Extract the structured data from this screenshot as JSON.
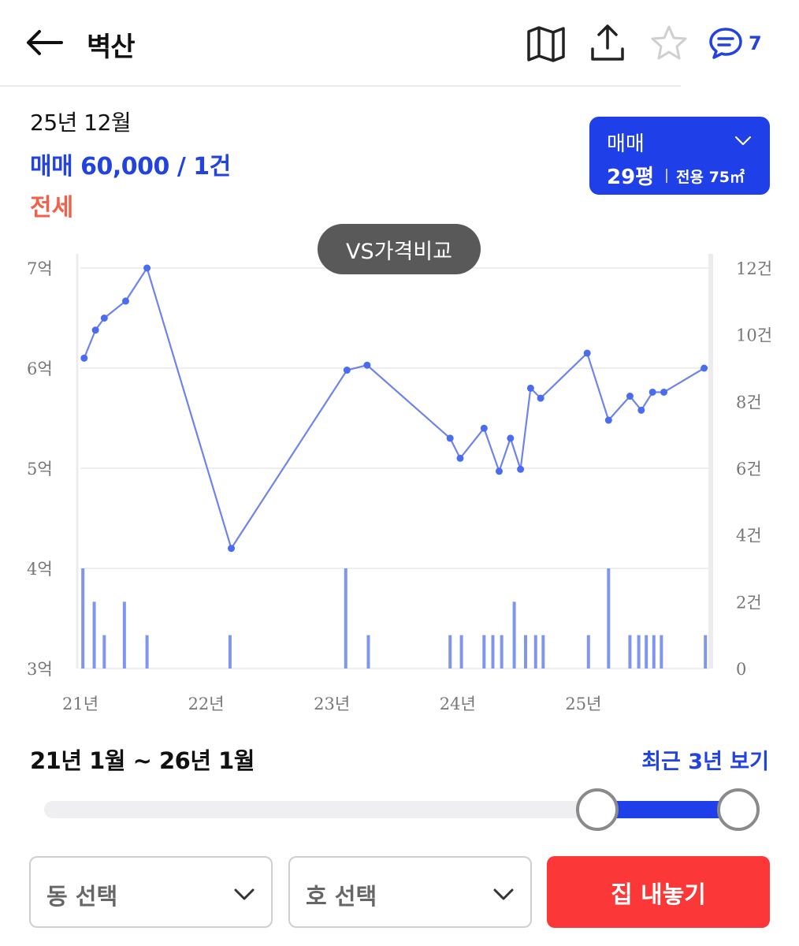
{
  "header": {
    "title": "벽산",
    "comment_count": "7",
    "icons": [
      "back-arrow-icon",
      "map-icon",
      "share-icon",
      "star-icon",
      "comment-icon"
    ]
  },
  "summary": {
    "period": "25년 12월",
    "sale_line": "매매 60,000 / 1건",
    "jeonse_line": "전세"
  },
  "type_select": {
    "trade_type": "매매",
    "size": "29평",
    "area": "전용 75㎡"
  },
  "vs_button": "VS가격비교",
  "colors": {
    "accent": "#1f3fe8",
    "line": "#6f84ea",
    "bar": "#8095f0",
    "dot": "#4a6cf0",
    "jeonse": "#f0604a",
    "sell": "#fb3737"
  },
  "chart_data": {
    "type": "line",
    "x_tick_labels": [
      "21년",
      "22년",
      "23년",
      "24년",
      "25년"
    ],
    "x_tick_positions": [
      2021,
      2022,
      2023,
      2024,
      2025
    ],
    "xlim": [
      2021,
      2026
    ],
    "y_left_ticks": [
      "3억",
      "4억",
      "5억",
      "6억",
      "7억"
    ],
    "y_left_values": [
      3,
      4,
      5,
      6,
      7
    ],
    "ylim_left": [
      3,
      7
    ],
    "y_right_ticks": [
      "0",
      "2건",
      "4건",
      "6건",
      "8건",
      "10건",
      "12건"
    ],
    "y_right_values": [
      0,
      2,
      4,
      6,
      8,
      10,
      12
    ],
    "ylim_right": [
      0,
      12
    ],
    "series": [
      {
        "kind": "line",
        "x": [
          2021.03,
          2021.12,
          2021.19,
          2021.36,
          2021.53,
          2022.2,
          2023.12,
          2023.28,
          2023.94,
          2024.02,
          2024.21,
          2024.33,
          2024.42,
          2024.5,
          2024.58,
          2024.66,
          2025.03,
          2025.2,
          2025.37,
          2025.46,
          2025.55,
          2025.64,
          2025.96
        ],
        "y": [
          6.1,
          6.38,
          6.5,
          6.67,
          7.0,
          4.2,
          5.98,
          6.03,
          5.3,
          5.1,
          5.4,
          4.97,
          5.3,
          4.99,
          5.8,
          5.7,
          6.15,
          5.48,
          5.72,
          5.58,
          5.76,
          5.76,
          6.0
        ]
      },
      {
        "kind": "bar",
        "x": [
          2021.02,
          2021.11,
          2021.19,
          2021.35,
          2021.53,
          2022.19,
          2023.11,
          2023.29,
          2023.94,
          2024.03,
          2024.21,
          2024.28,
          2024.35,
          2024.45,
          2024.54,
          2024.62,
          2024.68,
          2025.04,
          2025.2,
          2025.37,
          2025.44,
          2025.5,
          2025.56,
          2025.62,
          2025.97
        ],
        "values": [
          3,
          2,
          1,
          2,
          1,
          1,
          3,
          1,
          1,
          1,
          1,
          1,
          1,
          2,
          1,
          1,
          1,
          1,
          3,
          1,
          1,
          1,
          1,
          1,
          1
        ]
      }
    ],
    "grid": true
  },
  "range": {
    "label": "21년 1월 ~ 26년 1월",
    "recent_link": "최근 3년 보기",
    "start_fraction": 0.8,
    "end_fraction": 1.0
  },
  "bottom": {
    "dong_select": "동 선택",
    "ho_select": "호 선택",
    "sell_button": "집 내놓기"
  }
}
